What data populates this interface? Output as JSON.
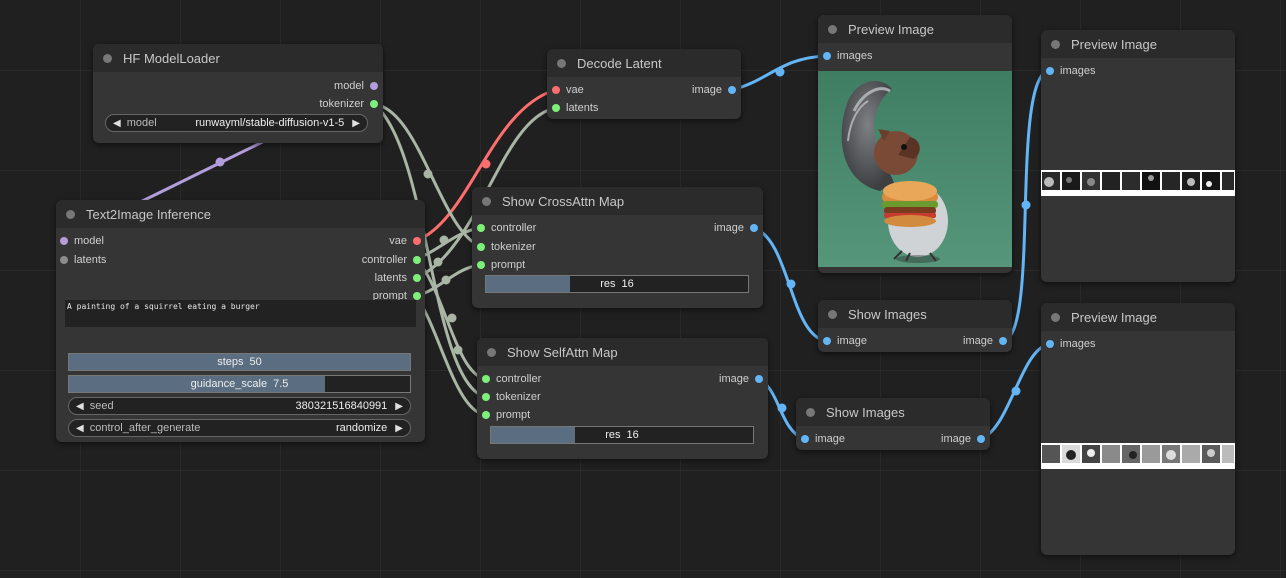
{
  "nodes": {
    "hf_model_loader": {
      "title": "HF ModelLoader",
      "outputs": {
        "model": "model",
        "tokenizer": "tokenizer"
      },
      "model_widget": {
        "label": "model",
        "value": "runwayml/stable-diffusion-v1-5"
      }
    },
    "text2image": {
      "title": "Text2Image Inference",
      "inputs": {
        "model": "model",
        "latents": "latents"
      },
      "outputs": {
        "vae": "vae",
        "controller": "controller",
        "latents": "latents",
        "prompt": "prompt"
      },
      "prompt_text": "A painting of a squirrel eating a burger",
      "steps": {
        "label": "steps",
        "value": "50",
        "fill_fraction": 1.0
      },
      "guidance_scale": {
        "label": "guidance_scale",
        "value": "7.5",
        "fill_fraction": 0.75
      },
      "seed": {
        "label": "seed",
        "value": "380321516840991"
      },
      "control_after_generate": {
        "label": "control_after_generate",
        "value": "randomize"
      }
    },
    "decode_latent": {
      "title": "Decode Latent",
      "inputs": {
        "vae": "vae",
        "latents": "latents"
      },
      "outputs": {
        "image": "image"
      }
    },
    "show_crossattn": {
      "title": "Show CrossAttn Map",
      "inputs": {
        "controller": "controller",
        "tokenizer": "tokenizer",
        "prompt": "prompt"
      },
      "outputs": {
        "image": "image"
      },
      "res": {
        "label": "res",
        "value": "16",
        "fill_fraction": 0.32
      }
    },
    "show_selfattn": {
      "title": "Show SelfAttn Map",
      "inputs": {
        "controller": "controller",
        "tokenizer": "tokenizer",
        "prompt": "prompt"
      },
      "outputs": {
        "image": "image"
      },
      "res": {
        "label": "res",
        "value": "16",
        "fill_fraction": 0.32
      }
    },
    "preview_1": {
      "title": "Preview Image",
      "inputs": {
        "images": "images"
      }
    },
    "show_images_1": {
      "title": "Show Images",
      "inputs": {
        "image": "image"
      },
      "outputs": {
        "image": "image"
      }
    },
    "preview_2": {
      "title": "Preview Image",
      "inputs": {
        "images": "images"
      }
    },
    "show_images_2": {
      "title": "Show Images",
      "inputs": {
        "image": "image"
      },
      "outputs": {
        "image": "image"
      }
    },
    "preview_3": {
      "title": "Preview Image",
      "inputs": {
        "images": "images"
      }
    }
  },
  "icons": {
    "arrow_left": "◀",
    "arrow_right": "▶"
  },
  "colors": {
    "canvas": "#202020",
    "node_body": "#353535",
    "model_wire": "#b39ddb",
    "vae_wire": "#ff6e6e",
    "conditioning_wire": "#a9b5a5",
    "image_wire": "#64b5f6"
  }
}
